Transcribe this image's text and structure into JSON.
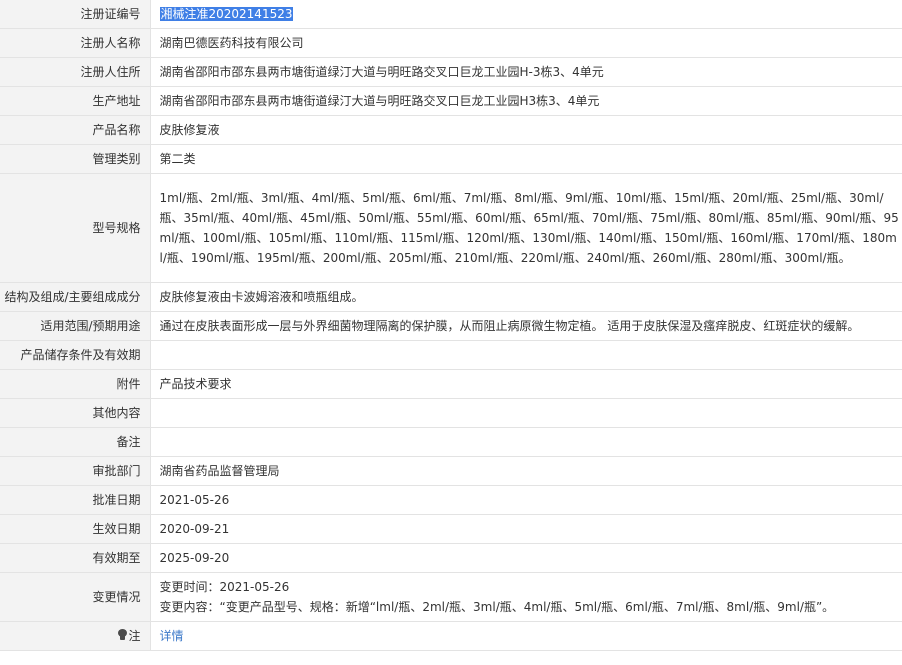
{
  "rows": [
    {
      "label": "注册证编号",
      "value": "湘械注准20202141523"
    },
    {
      "label": "注册人名称",
      "value": "湖南巴德医药科技有限公司"
    },
    {
      "label": "注册人住所",
      "value": "湖南省邵阳市邵东县两市塘街道绿汀大道与明旺路交叉口巨龙工业园H-3栋3、4单元"
    },
    {
      "label": "生产地址",
      "value": "湖南省邵阳市邵东县两市塘街道绿汀大道与明旺路交叉口巨龙工业园H3栋3、4单元"
    },
    {
      "label": "产品名称",
      "value": "皮肤修复液"
    },
    {
      "label": "管理类别",
      "value": "第二类"
    },
    {
      "label": "型号规格",
      "value": "1ml/瓶、2ml/瓶、3ml/瓶、4ml/瓶、5ml/瓶、6ml/瓶、7ml/瓶、8ml/瓶、9ml/瓶、10ml/瓶、15ml/瓶、20ml/瓶、25ml/瓶、30ml/瓶、35ml/瓶、40ml/瓶、45ml/瓶、50ml/瓶、55ml/瓶、60ml/瓶、65ml/瓶、70ml/瓶、75ml/瓶、80ml/瓶、85ml/瓶、90ml/瓶、95ml/瓶、100ml/瓶、105ml/瓶、110ml/瓶、115ml/瓶、120ml/瓶、130ml/瓶、140ml/瓶、150ml/瓶、160ml/瓶、170ml/瓶、180ml/瓶、190ml/瓶、195ml/瓶、200ml/瓶、205ml/瓶、210ml/瓶、220ml/瓶、240ml/瓶、260ml/瓶、280ml/瓶、300ml/瓶。"
    },
    {
      "label": "结构及组成/主要组成成分",
      "value": "皮肤修复液由卡波姆溶液和喷瓶组成。"
    },
    {
      "label": "适用范围/预期用途",
      "value": "通过在皮肤表面形成一层与外界细菌物理隔离的保护膜，从而阻止病原微生物定植。 适用于皮肤保湿及瘙痒脱皮、红斑症状的缓解。"
    },
    {
      "label": "产品储存条件及有效期",
      "value": ""
    },
    {
      "label": "附件",
      "value": "产品技术要求"
    },
    {
      "label": "其他内容",
      "value": ""
    },
    {
      "label": "备注",
      "value": ""
    },
    {
      "label": "审批部门",
      "value": "湖南省药品监督管理局"
    },
    {
      "label": "批准日期",
      "value": "2021-05-26"
    },
    {
      "label": "生效日期",
      "value": "2020-09-21"
    },
    {
      "label": "有效期至",
      "value": "2025-09-20"
    }
  ],
  "change": {
    "label": "变更情况",
    "time_line": "变更时间：2021-05-26",
    "content_line": "变更内容：“变更产品型号、规格：新增“lml/瓶、2ml/瓶、3ml/瓶、4ml/瓶、5ml/瓶、6ml/瓶、7ml/瓶、8ml/瓶、9ml/瓶”。"
  },
  "note": {
    "label": "注",
    "icon": "lightbulb-icon",
    "link_text": "详情"
  },
  "colors": {
    "label_bg": "#f3f3f3",
    "border": "#e3e3e3",
    "selection": "#3f7fe6",
    "link": "#3c79c9"
  }
}
